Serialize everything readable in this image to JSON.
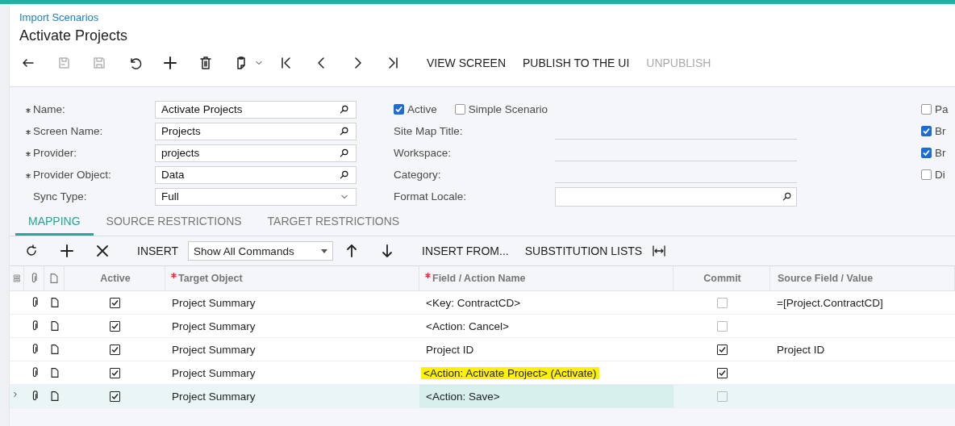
{
  "breadcrumb": "Import Scenarios",
  "title": "Activate Projects",
  "toolbar": {
    "icons": [
      {
        "kind": "back",
        "disabled": false
      },
      {
        "kind": "save-close",
        "disabled": true
      },
      {
        "kind": "save",
        "disabled": true
      },
      {
        "kind": "undo",
        "disabled": false
      },
      {
        "kind": "add",
        "disabled": false
      },
      {
        "kind": "delete",
        "disabled": false
      },
      {
        "kind": "clipboard",
        "disabled": false
      },
      {
        "kind": "first",
        "disabled": false
      },
      {
        "kind": "prev",
        "disabled": false
      },
      {
        "kind": "next",
        "disabled": false
      },
      {
        "kind": "last",
        "disabled": false
      }
    ],
    "buttons": [
      {
        "label": "VIEW SCREEN",
        "disabled": false
      },
      {
        "label": "PUBLISH TO THE UI",
        "disabled": false
      },
      {
        "label": "UNPUBLISH",
        "disabled": true
      }
    ]
  },
  "form": {
    "left": [
      {
        "label": "Name:",
        "required": true,
        "kind": "lookup",
        "value": "Activate Projects"
      },
      {
        "label": "Screen Name:",
        "required": true,
        "kind": "lookup",
        "value": "Projects"
      },
      {
        "label": "Provider:",
        "required": true,
        "kind": "lookup",
        "value": "projects"
      },
      {
        "label": "Provider Object:",
        "required": true,
        "kind": "lookup",
        "value": "Data"
      },
      {
        "label": "Sync Type:",
        "required": false,
        "kind": "select",
        "value": "Full"
      }
    ],
    "checks": [
      {
        "label": "Active",
        "checked": true
      },
      {
        "label": "Simple Scenario",
        "checked": false
      }
    ],
    "middle": [
      {
        "label": "Site Map Title:",
        "kind": "line"
      },
      {
        "label": "Workspace:",
        "kind": "line"
      },
      {
        "label": "Category:",
        "kind": "line"
      },
      {
        "label": "Format Locale:",
        "kind": "lookup"
      }
    ],
    "right": [
      {
        "label": "Pa",
        "checked": false
      },
      {
        "label": "Br",
        "checked": true
      },
      {
        "label": "Br",
        "checked": true
      },
      {
        "label": "Di",
        "checked": false
      }
    ]
  },
  "tabs": [
    {
      "label": "MAPPING",
      "selected": true
    },
    {
      "label": "SOURCE RESTRICTIONS",
      "selected": false
    },
    {
      "label": "TARGET RESTRICTIONS",
      "selected": false
    }
  ],
  "grid_toolbar": {
    "icons": [
      {
        "kind": "refresh"
      },
      {
        "kind": "add"
      },
      {
        "kind": "remove"
      }
    ],
    "insert": "INSERT",
    "filter": "Show All Commands",
    "arrows": [
      {
        "kind": "up"
      },
      {
        "kind": "down"
      }
    ],
    "buttons": [
      "INSERT FROM...",
      "SUBSTITUTION LISTS"
    ]
  },
  "table": {
    "columns": [
      {
        "label": "Active",
        "required": false
      },
      {
        "label": "Target Object",
        "required": true
      },
      {
        "label": "Field / Action Name",
        "required": true
      },
      {
        "label": "Commit",
        "required": false
      },
      {
        "label": "Source Field / Value",
        "required": false
      }
    ],
    "rows": [
      {
        "selected": false,
        "active": true,
        "target": "Project Summary",
        "field": "<Key: ContractCD>",
        "highlighted": false,
        "commit": false,
        "source": "=[Project.ContractCD]"
      },
      {
        "selected": false,
        "active": true,
        "target": "Project Summary",
        "field": "<Action: Cancel>",
        "highlighted": false,
        "commit": false
      },
      {
        "selected": false,
        "active": true,
        "target": "Project Summary",
        "field": "Project ID",
        "highlighted": false,
        "commit": true,
        "source": "Project ID"
      },
      {
        "selected": false,
        "active": true,
        "target": "Project Summary",
        "field": "<Action: Activate Project> (Activate)",
        "highlighted": true,
        "commit": true
      },
      {
        "selected": true,
        "active": true,
        "target": "Project Summary",
        "field": "<Action: Save>",
        "highlighted": false,
        "commit": false
      }
    ]
  }
}
